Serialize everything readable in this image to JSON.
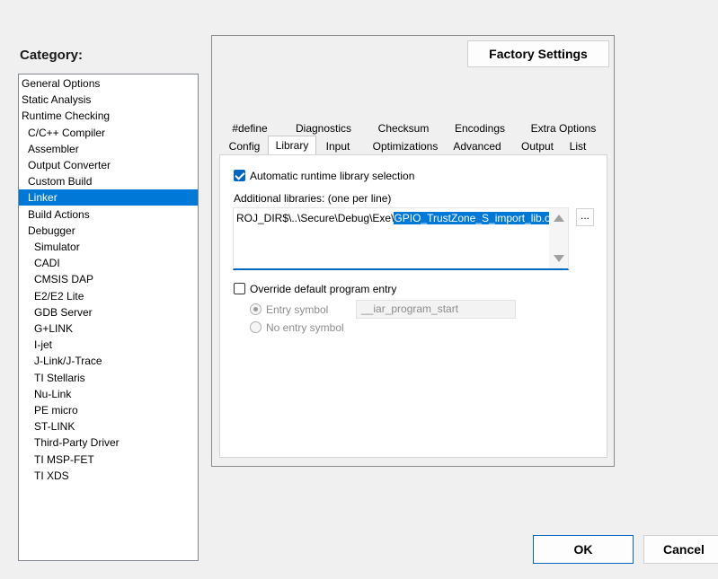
{
  "category": {
    "label": "Category:",
    "items": [
      {
        "label": "General Options",
        "indent": 0
      },
      {
        "label": "Static Analysis",
        "indent": 0
      },
      {
        "label": "Runtime Checking",
        "indent": 0
      },
      {
        "label": "C/C++ Compiler",
        "indent": 1
      },
      {
        "label": "Assembler",
        "indent": 1
      },
      {
        "label": "Output Converter",
        "indent": 1
      },
      {
        "label": "Custom Build",
        "indent": 1
      },
      {
        "label": "Linker",
        "indent": 1,
        "selected": true
      },
      {
        "label": "Build Actions",
        "indent": 1
      },
      {
        "label": "Debugger",
        "indent": 1
      },
      {
        "label": "Simulator",
        "indent": 2
      },
      {
        "label": "CADI",
        "indent": 2
      },
      {
        "label": "CMSIS DAP",
        "indent": 2
      },
      {
        "label": "E2/E2 Lite",
        "indent": 2
      },
      {
        "label": "GDB Server",
        "indent": 2
      },
      {
        "label": "G+LINK",
        "indent": 2
      },
      {
        "label": "I-jet",
        "indent": 2
      },
      {
        "label": "J-Link/J-Trace",
        "indent": 2
      },
      {
        "label": "TI Stellaris",
        "indent": 2
      },
      {
        "label": "Nu-Link",
        "indent": 2
      },
      {
        "label": "PE micro",
        "indent": 2
      },
      {
        "label": "ST-LINK",
        "indent": 2
      },
      {
        "label": "Third-Party Driver",
        "indent": 2
      },
      {
        "label": "TI MSP-FET",
        "indent": 2
      },
      {
        "label": "TI XDS",
        "indent": 2
      }
    ]
  },
  "factory_settings_label": "Factory Settings",
  "tabs": {
    "row1": [
      "#define",
      "Diagnostics",
      "Checksum",
      "Encodings",
      "Extra Options"
    ],
    "row2": [
      "Config",
      "Library",
      "Input",
      "Optimizations",
      "Advanced",
      "Output",
      "List"
    ],
    "active": "Library"
  },
  "library": {
    "auto_lib_label": "Automatic runtime library selection",
    "auto_lib_checked": true,
    "additional_label": "Additional libraries: (one per line)",
    "libs_prefix": "ROJ_DIR$\\..\\Secure\\Debug\\Exe\\",
    "libs_selected": "GPIO_TrustZone_S_import_lib.o",
    "browse_label": "...",
    "override_label": "Override default program entry",
    "override_checked": false,
    "entry_symbol_label": "Entry symbol",
    "entry_symbol_value": "__iar_program_start",
    "no_entry_label": "No entry symbol"
  },
  "buttons": {
    "ok": "OK",
    "cancel": "Cancel"
  }
}
